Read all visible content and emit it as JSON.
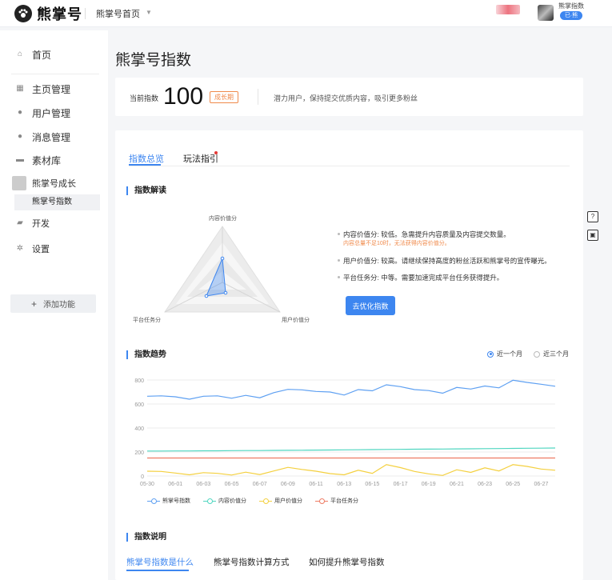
{
  "header": {
    "logo_text": "熊掌号",
    "home_link": "熊掌号首页",
    "user_tag": "熊掌指数",
    "user_badge": "已·熊"
  },
  "sidebar": {
    "items": [
      {
        "label": "首页",
        "icon": "home-icon"
      },
      {
        "label": "主页管理",
        "icon": "grid-icon"
      },
      {
        "label": "用户管理",
        "icon": "user-icon"
      },
      {
        "label": "消息管理",
        "icon": "message-icon"
      },
      {
        "label": "素材库",
        "icon": "folder-icon"
      },
      {
        "label": "熊掌号成长",
        "icon": "growth-icon"
      },
      {
        "label": "开发",
        "icon": "dev-icon"
      },
      {
        "label": "设置",
        "icon": "gear-icon"
      }
    ],
    "sub_item": "熊掌号指数",
    "add_button": "添加功能"
  },
  "page": {
    "title": "熊掌号指数",
    "current_label": "当前指数",
    "current_value": "100",
    "stage": "成长期",
    "description": "潜力用户，保持提交优质内容，吸引更多粉丝"
  },
  "tabs": [
    {
      "label": "指数总览",
      "active": true
    },
    {
      "label": "玩法指引",
      "active": false
    }
  ],
  "interpretation": {
    "title": "指数解读",
    "radar_labels": {
      "top": "内容价值分",
      "left": "平台任务分",
      "right": "用户价值分"
    },
    "bullets": [
      "内容价值分: 较低。急需提升内容质量及内容提交数量。",
      "用户价值分: 较高。请继续保持高度的粉丝活跃和熊掌号的宣传曝光。",
      "平台任务分: 中等。需要加速完成平台任务获得提升。"
    ],
    "hint": "内容总量不足10时，无法获得内容价值分。",
    "button": "去优化指数"
  },
  "trend": {
    "title": "指数趋势",
    "range_options": [
      {
        "label": "近一个月",
        "selected": true
      },
      {
        "label": "近三个月",
        "selected": false
      }
    ]
  },
  "chart_data": {
    "type": "line",
    "x": [
      "05-30",
      "05-31",
      "06-01",
      "06-02",
      "06-03",
      "06-04",
      "06-05",
      "06-06",
      "06-07",
      "06-08",
      "06-09",
      "06-10",
      "06-11",
      "06-12",
      "06-13",
      "06-14",
      "06-15",
      "06-16",
      "06-17",
      "06-18",
      "06-19",
      "06-20",
      "06-21",
      "06-22",
      "06-23",
      "06-24",
      "06-25",
      "06-26",
      "06-27",
      "06-28"
    ],
    "x_tick_labels": [
      "05-30",
      "06-01",
      "06-03",
      "06-05",
      "06-07",
      "06-09",
      "06-11",
      "06-13",
      "06-15",
      "06-17",
      "06-19",
      "06-21",
      "06-23",
      "06-25",
      "06-27"
    ],
    "ylim": [
      0,
      800
    ],
    "y_ticks": [
      0,
      200,
      400,
      600,
      800
    ],
    "grid": true,
    "legend_position": "bottom",
    "series": [
      {
        "name": "熊掌号指数",
        "color": "#5ea0f2",
        "values": [
          665,
          668,
          660,
          640,
          665,
          668,
          648,
          672,
          652,
          695,
          722,
          718,
          705,
          700,
          675,
          720,
          710,
          760,
          745,
          720,
          712,
          690,
          738,
          725,
          750,
          735,
          798,
          780,
          765,
          748
        ]
      },
      {
        "name": "内容价值分",
        "color": "#4fd6c0",
        "values": [
          208,
          208,
          209,
          209,
          210,
          210,
          211,
          212,
          212,
          213,
          214,
          215,
          216,
          217,
          218,
          219,
          220,
          221,
          222,
          223,
          224,
          225,
          226,
          227,
          228,
          229,
          230,
          231,
          232,
          233
        ]
      },
      {
        "name": "用户价值分",
        "color": "#f4d03f",
        "values": [
          40,
          38,
          25,
          10,
          28,
          22,
          8,
          32,
          12,
          42,
          72,
          55,
          40,
          20,
          10,
          48,
          22,
          95,
          70,
          38,
          18,
          5,
          52,
          30,
          68,
          42,
          95,
          80,
          58,
          48
        ]
      },
      {
        "name": "平台任务分",
        "color": "#ee7b63",
        "values": [
          150,
          150,
          150,
          150,
          150,
          150,
          150,
          150,
          150,
          150,
          150,
          150,
          150,
          150,
          150,
          150,
          150,
          150,
          150,
          150,
          150,
          150,
          150,
          150,
          150,
          150,
          150,
          150,
          150,
          150
        ]
      }
    ]
  },
  "explanation": {
    "title": "指数说明",
    "tabs": [
      "熊掌号指数是什么",
      "熊掌号指数计算方式",
      "如何提升熊掌号指数"
    ]
  }
}
